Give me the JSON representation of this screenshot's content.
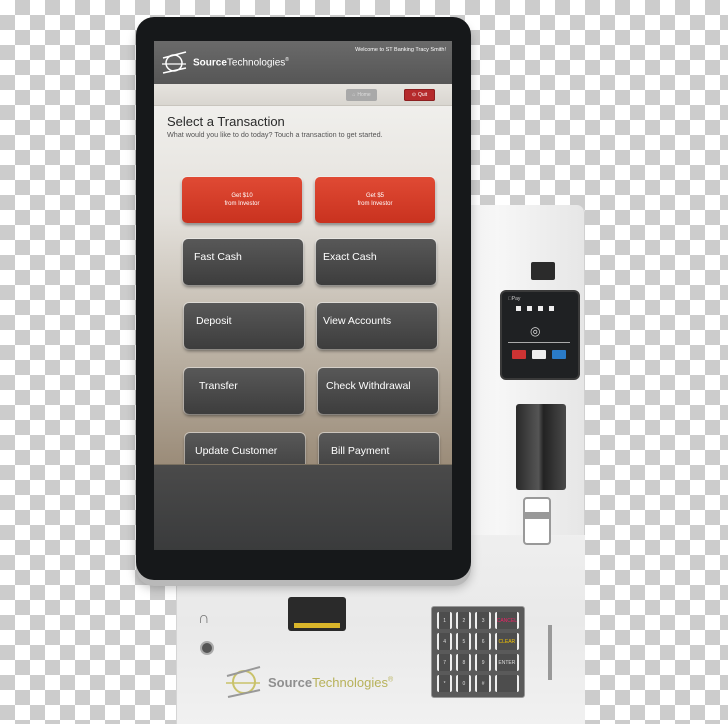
{
  "screen": {
    "header": {
      "brand_bold": "Source",
      "brand_rest": "Technologies",
      "brand_mark": "®",
      "welcome": "Welcome to ST Banking Tracy Smith!"
    },
    "toolbar": {
      "home_label": "Home",
      "quit_label": "Quit"
    },
    "main": {
      "title": "Select a Transaction",
      "subtitle": "What would you like to do today? Touch a transaction to get started.",
      "promo_buttons": [
        {
          "line1": "Get $10",
          "line2": "from Investor"
        },
        {
          "line1": "Get $5",
          "line2": "from Investor"
        }
      ],
      "transactions": [
        {
          "label": "Fast Cash"
        },
        {
          "label": "Exact Cash"
        },
        {
          "label": "Deposit"
        },
        {
          "label": "View Accounts"
        },
        {
          "label": "Transfer"
        },
        {
          "label": "Check Withdrawal"
        },
        {
          "label": "Update Customer"
        },
        {
          "label": "Bill Payment"
        }
      ]
    }
  },
  "hardware": {
    "reader_label": "Pay",
    "keypad_keys": [
      "1",
      "2",
      "3",
      "CANCEL",
      "4",
      "5",
      "6",
      "CLEAR",
      "7",
      "8",
      "9",
      "ENTER",
      "*",
      "0",
      "#",
      ""
    ],
    "bottom_brand_bold": "Source",
    "bottom_brand_rest": "Technologies",
    "bottom_brand_mark": "®"
  },
  "colors": {
    "promo_red": "#d63d28",
    "quit_red": "#b52a2c",
    "tile_dark": "#4a4a4a",
    "brand_gold": "#b8b25a"
  }
}
